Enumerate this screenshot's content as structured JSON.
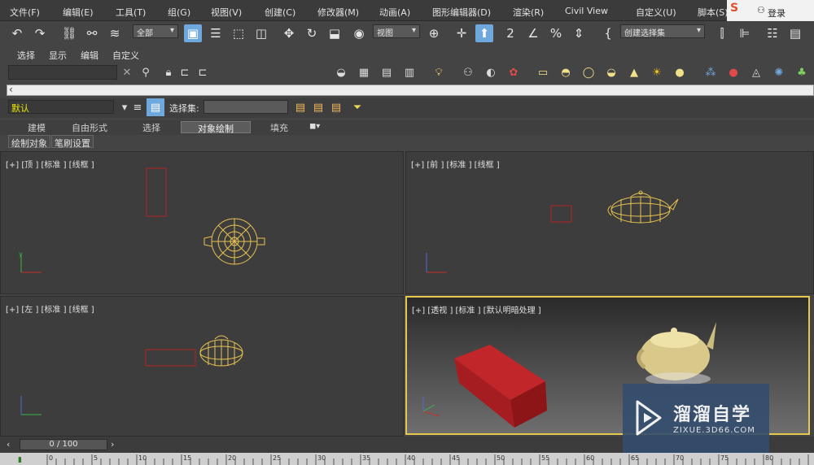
{
  "menubar": {
    "items": [
      "文件(F)",
      "编辑(E)",
      "工具(T)",
      "组(G)",
      "视图(V)",
      "创建(C)",
      "修改器(M)",
      "动画(A)",
      "图形编辑器(D)",
      "渲染(R)",
      "Civil View",
      "自定义(U)",
      "脚本(S)"
    ],
    "login": "登录"
  },
  "toolbar": {
    "filter_value": "全部",
    "refcoord_value": "视图",
    "named_selset_placeholder": "创建选择集"
  },
  "bar2": {
    "items": [
      "选择",
      "显示",
      "编辑",
      "自定义"
    ]
  },
  "layerbar": {
    "layer_value": "默认",
    "selset_label": "选择集:"
  },
  "ribbon": {
    "tabs": [
      "建模",
      "自由形式",
      "选择",
      "对象绘制",
      "填充"
    ],
    "subtabs": [
      "绘制对象",
      "笔刷设置"
    ]
  },
  "viewports": {
    "top": "[+] [顶 ] [标准 ] [线框 ]",
    "front": "[+] [前 ] [标准 ] [线框 ]",
    "left": "[+] [左 ] [标准 ] [线框 ]",
    "perspective": "[+] [透视 ] [标准 ] [默认明暗处理 ]"
  },
  "timeline": {
    "frame_value": "0 / 100",
    "ruler_labels": [
      "0",
      "5",
      "10",
      "15",
      "20",
      "25",
      "30",
      "35",
      "40",
      "45",
      "50",
      "55",
      "60",
      "65",
      "70",
      "75",
      "80"
    ]
  },
  "watermark": {
    "title": "溜溜自学",
    "subtitle": "ZIXUE.3D66.COM"
  },
  "colors": {
    "accent": "#6fa8dc",
    "teapot_wire": "#e8c24f",
    "box_wire": "#b22222",
    "active_viewport": "#e6c84f"
  }
}
